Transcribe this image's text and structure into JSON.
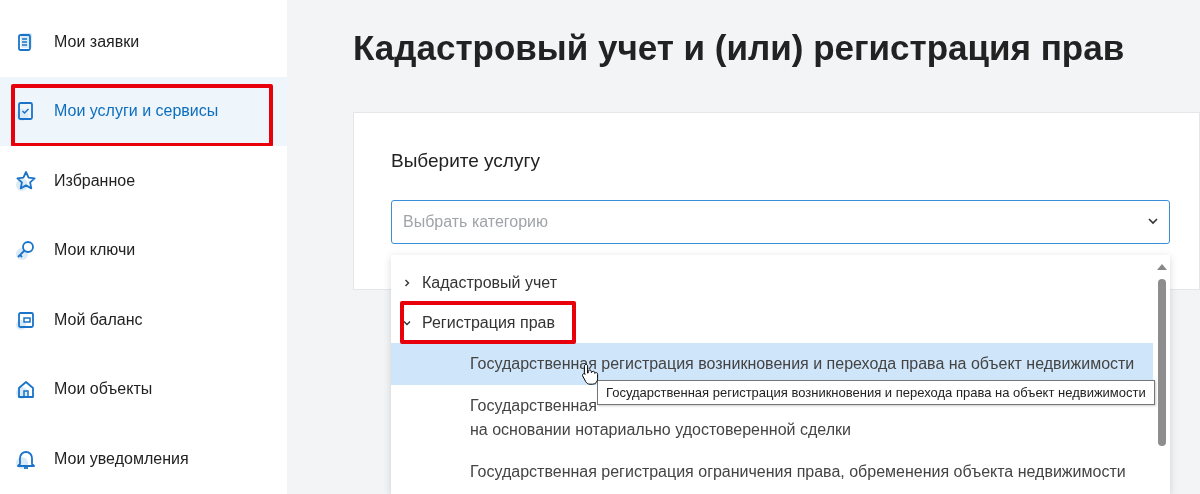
{
  "sidebar": {
    "items": [
      {
        "label": "Мои заявки",
        "selected": false,
        "highlighted": false
      },
      {
        "label": "Мои услуги и сервисы",
        "selected": true,
        "highlighted": true
      },
      {
        "label": "Избранное",
        "selected": false,
        "highlighted": false
      },
      {
        "label": "Мои ключи",
        "selected": false,
        "highlighted": false
      },
      {
        "label": "Мой баланс",
        "selected": false,
        "highlighted": false
      },
      {
        "label": "Мои объекты",
        "selected": false,
        "highlighted": false
      },
      {
        "label": "Мои уведомления",
        "selected": false,
        "highlighted": false
      }
    ]
  },
  "page_title": "Кадастровый учет и (или) регистрация прав",
  "card": {
    "heading": "Выберите услугу",
    "select": {
      "placeholder": "Выбрать категорию",
      "expanded": true
    },
    "options": [
      {
        "label": "Кадастровый учет",
        "expanded": false,
        "highlighted": false
      },
      {
        "label": "Регистрация прав",
        "expanded": true,
        "highlighted": true,
        "children": [
          {
            "lines": [
              "Государственная регистрация возникновения и перехода права на объект недвижимости"
            ],
            "selected": true
          },
          {
            "lines": [
              "Государственная",
              "на основании нотариально удостоверенной сделки"
            ],
            "selected": false
          },
          {
            "lines": [
              "Государственная регистрация ограничения права, обременения объекта недвижимости"
            ],
            "selected": false
          }
        ]
      }
    ]
  },
  "tooltip": "Государственная регистрация возникновения и перехода права на объект недвижимости"
}
